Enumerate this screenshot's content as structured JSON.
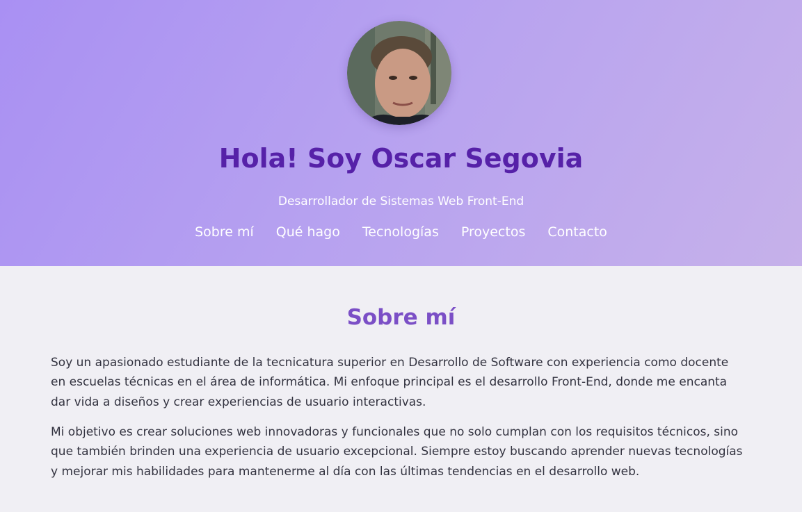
{
  "header": {
    "greeting": "Hola! Soy Oscar Segovia",
    "subtitle": "Desarrollador de Sistemas Web Front-End",
    "nav": [
      {
        "label": "Sobre mí"
      },
      {
        "label": "Qué hago"
      },
      {
        "label": "Tecnologías"
      },
      {
        "label": "Proyectos"
      },
      {
        "label": "Contacto"
      }
    ]
  },
  "about": {
    "heading": "Sobre mí",
    "paragraphs": [
      "Soy un apasionado estudiante de la tecnicatura superior en Desarrollo de Software con experiencia como docente en escuelas técnicas en el área de informática. Mi enfoque principal es el desarrollo Front-End, donde me encanta dar vida a diseños y crear experiencias de usuario interactivas.",
      "Mi objetivo es crear soluciones web innovadoras y funcionales que no solo cumplan con los requisitos técnicos, sino que también brinden una experiencia de usuario excepcional. Siempre estoy buscando aprender nuevas tecnologías y mejorar mis habilidades para mantenerme al día con las últimas tendencias en el desarrollo web."
    ]
  },
  "colors": {
    "hero_gradient_start": "#a990f3",
    "hero_gradient_end": "#c6b1ea",
    "title_purple": "#5621a8",
    "heading_purple": "#7b4fc6",
    "page_background": "#f0eff4",
    "body_text": "#333340"
  },
  "icons": {
    "avatar": "profile-photo"
  }
}
